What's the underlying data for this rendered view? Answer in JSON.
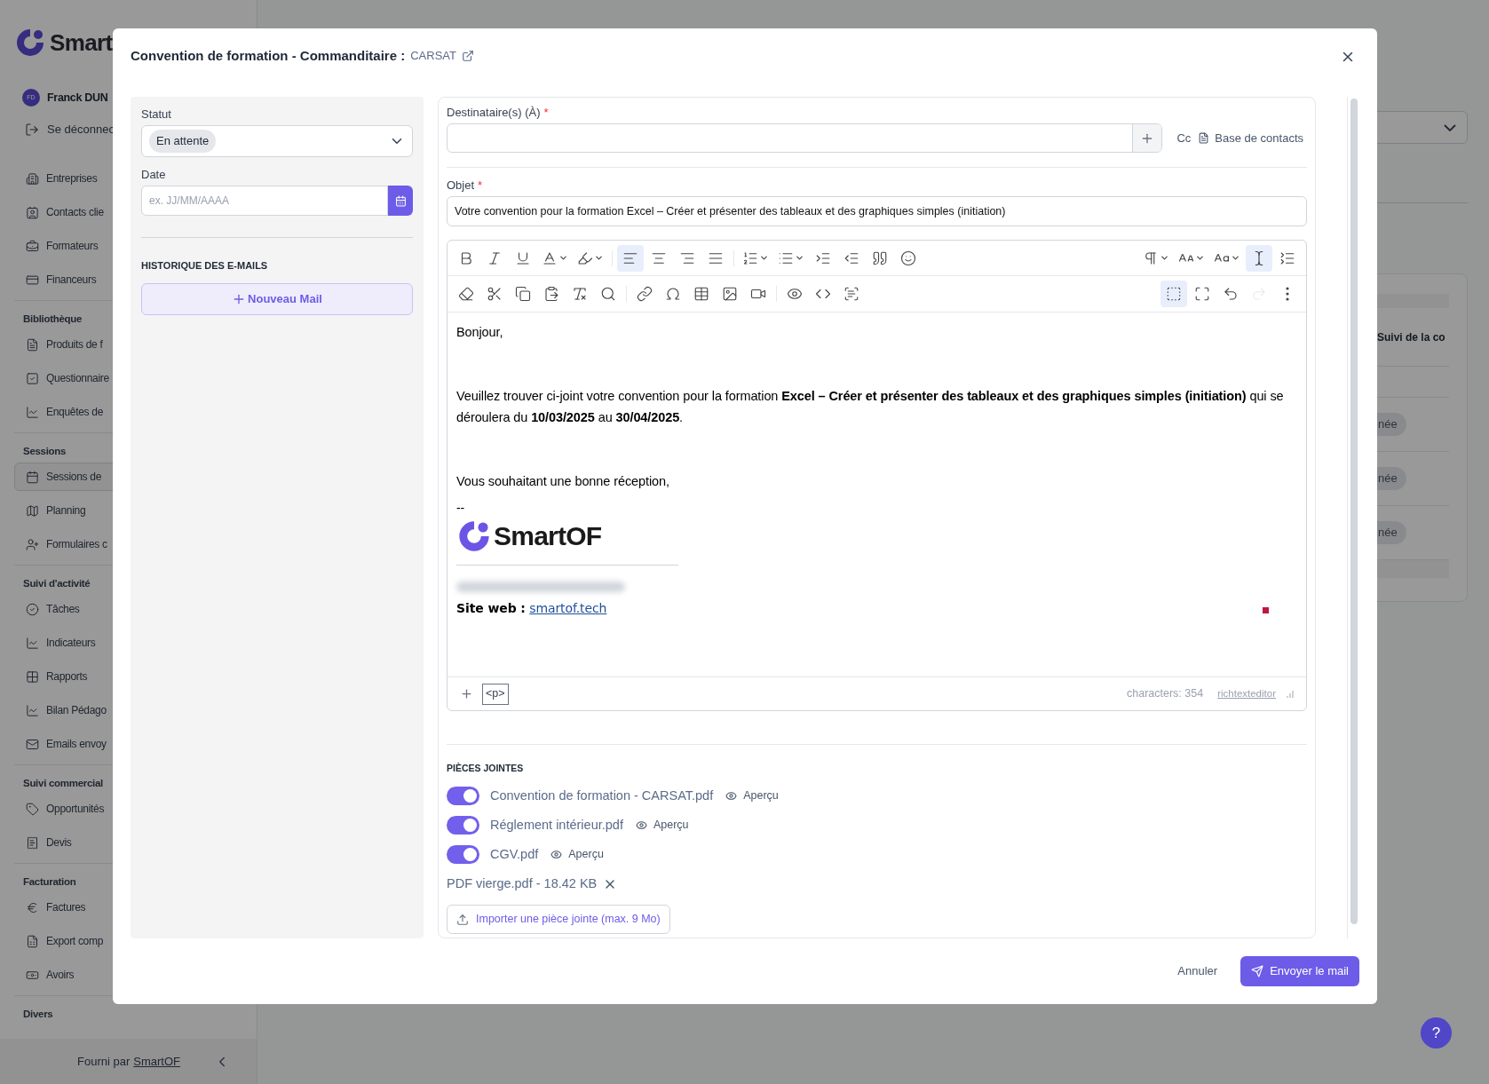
{
  "sidebar": {
    "brand": "Smart",
    "user": {
      "initials": "FD",
      "name": "Franck DUN"
    },
    "logout": "Se déconnec",
    "groups": [
      {
        "items": [
          {
            "label": "Entreprises",
            "selected": false
          },
          {
            "label": "Contacts clie",
            "selected": false
          },
          {
            "label": "Formateurs",
            "selected": false
          },
          {
            "label": "Financeurs",
            "selected": false
          }
        ]
      },
      {
        "title": "Bibliothèque",
        "items": [
          {
            "label": "Produits de f",
            "selected": false
          },
          {
            "label": "Questionnaire",
            "selected": false
          },
          {
            "label": "Enquêtes de",
            "selected": false
          }
        ]
      },
      {
        "title": "Sessions",
        "items": [
          {
            "label": "Sessions de",
            "selected": true
          },
          {
            "label": "Planning",
            "selected": false
          },
          {
            "label": "Formulaires c",
            "selected": false
          }
        ]
      },
      {
        "title": "Suivi d'activité",
        "items": [
          {
            "label": "Tâches",
            "selected": false
          },
          {
            "label": "Indicateurs",
            "selected": false
          },
          {
            "label": "Rapports",
            "selected": false
          },
          {
            "label": "Bilan Pédago",
            "selected": false
          },
          {
            "label": "Emails envoy",
            "selected": false
          }
        ]
      },
      {
        "title": "Suivi commercial",
        "items": [
          {
            "label": "Opportunités",
            "selected": false
          },
          {
            "label": "Devis",
            "selected": false
          }
        ]
      },
      {
        "title": "Facturation",
        "items": [
          {
            "label": "Factures",
            "selected": false
          },
          {
            "label": "Export comp",
            "selected": false
          },
          {
            "label": "Avoirs",
            "selected": false
          }
        ]
      },
      {
        "title": "Divers"
      }
    ],
    "footer": {
      "text": "Fourni par",
      "link": "SmartOF"
    }
  },
  "background": {
    "column_header": "Suivi de la co",
    "chips": [
      "née",
      "née",
      "née"
    ],
    "help": "?"
  },
  "modal": {
    "title": "Convention de formation - Commanditaire :",
    "sponsor_link": "CARSAT",
    "status": {
      "label": "Statut",
      "value": "En attente"
    },
    "date": {
      "label": "Date",
      "placeholder": "ex. JJ/MM/AAAA"
    },
    "history": {
      "title": "HISTORIQUE DES E-MAILS",
      "new_button": "Nouveau Mail"
    },
    "recipients": {
      "label": "Destinataire(s) (À)",
      "required_mark": "*",
      "cc": "Cc",
      "contacts_button": "Base de contacts"
    },
    "subject": {
      "label": "Objet",
      "required_mark": "*",
      "value": "Votre convention pour la formation Excel – Créer et présenter des tableaux et des graphiques simples (initiation)"
    },
    "editor": {
      "toolbar_rows": [
        [
          {
            "selected": false
          },
          {
            "selected": false
          },
          {
            "selected": false
          },
          {
            "selected": false
          },
          {
            "selected": false
          },
          {
            "selected": true
          },
          {
            "selected": false
          },
          {
            "selected": false
          },
          {
            "selected": false
          },
          {
            "selected": false
          },
          {
            "selected": false
          },
          {
            "selected": false
          },
          {
            "selected": false
          },
          {
            "selected": false
          },
          {
            "selected": false
          },
          {
            "selected": false
          },
          {
            "selected": false
          },
          {
            "selected": false
          },
          {
            "selected": true
          },
          {
            "selected": false
          }
        ],
        [
          {
            "selected": false,
            "disabled": false
          },
          {
            "selected": false,
            "disabled": false
          },
          {
            "selected": false,
            "disabled": false
          },
          {
            "selected": false,
            "disabled": false
          },
          {
            "selected": false,
            "disabled": false
          },
          {
            "selected": false,
            "disabled": false
          },
          {
            "selected": false,
            "disabled": false
          },
          {
            "selected": false,
            "disabled": false
          },
          {
            "selected": false,
            "disabled": false
          },
          {
            "selected": false,
            "disabled": false
          },
          {
            "selected": false,
            "disabled": false
          },
          {
            "selected": false,
            "disabled": false
          },
          {
            "selected": false,
            "disabled": false
          },
          {
            "selected": false,
            "disabled": false
          },
          {
            "selected": true,
            "disabled": false
          },
          {
            "selected": false,
            "disabled": false
          },
          {
            "selected": false,
            "disabled": false
          },
          {
            "selected": false,
            "disabled": true
          },
          {
            "selected": false,
            "disabled": false
          }
        ]
      ],
      "body": [
        {
          "kind": "paragraph",
          "text": "Bonjour,"
        },
        {
          "kind": "empty"
        },
        {
          "kind": "empty"
        },
        {
          "kind": "paragraph",
          "text": "Veuillez trouver ci-joint votre convention pour la formation **Excel – Créer et présenter des tableaux et des graphiques simples (initiation)** qui se déroulera du **10/03/2025** au **30/04/2025**."
        },
        {
          "kind": "empty"
        },
        {
          "kind": "empty"
        },
        {
          "kind": "paragraph",
          "text": "Vous souhaitant une bonne réception,"
        },
        {
          "kind": "signature",
          "separator": "--",
          "logo": "SmartOF",
          "website_label": "Site web :",
          "website": "smartof.tech"
        }
      ],
      "block_tag": "<p>",
      "character_count": "characters: 354",
      "brand_link": "richtexteditor"
    },
    "attachments": {
      "title": "PIÈCES JOINTES",
      "items": [
        {
          "name": "Convention de formation - CARSAT.pdf",
          "on": true,
          "preview": "Aperçu"
        },
        {
          "name": "Réglement intérieur.pdf",
          "on": true,
          "preview": "Aperçu"
        },
        {
          "name": "CGV.pdf",
          "on": true,
          "preview": "Aperçu"
        }
      ],
      "uploaded": [
        {
          "name": "PDF vierge.pdf - 18.42 KB"
        }
      ],
      "upload_button": "Importer une pièce jointe (max. 9 Mo)"
    },
    "cancel": "Annuler",
    "send": "Envoyer le mail"
  }
}
